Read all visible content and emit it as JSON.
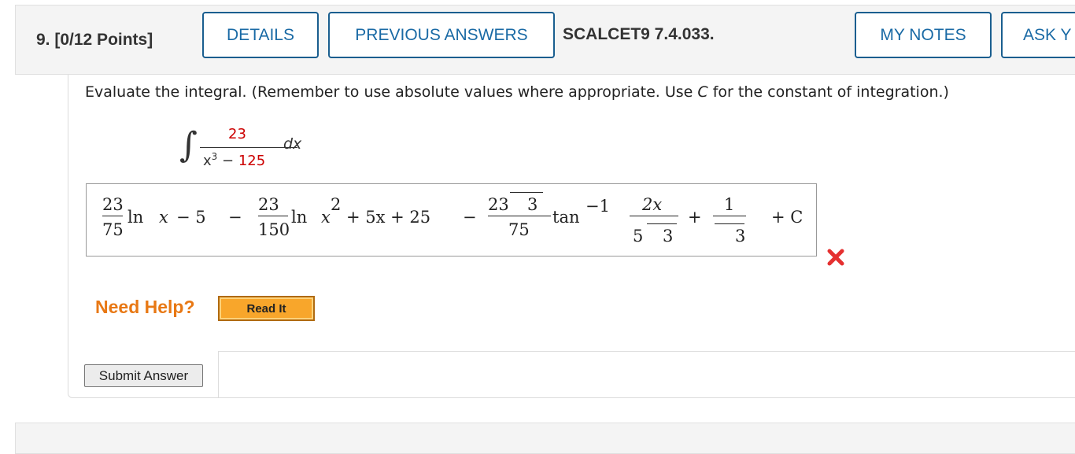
{
  "header": {
    "question_number": "9.",
    "points": "[0/12 Points]",
    "details_label": "DETAILS",
    "previous_answers_label": "PREVIOUS ANSWERS",
    "reference": "SCALCET9 7.4.033.",
    "my_notes_label": "MY NOTES",
    "ask_label": "ASK Y"
  },
  "question": {
    "prompt_before_c": "Evaluate the integral. (Remember to use absolute values where appropriate. Use ",
    "prompt_c": "C",
    "prompt_after_c": " for the constant of integration.)",
    "integrand_numerator": "23",
    "integrand_den_base": "x",
    "integrand_den_exp": "3",
    "integrand_den_op": " − ",
    "integrand_den_const": "125",
    "differential": "dx"
  },
  "answer": {
    "t1_num": "23",
    "t1_den": "75",
    "t1_fn": "ln",
    "t1_arg": "x",
    "t1_rest": "− 5",
    "minus1": "−",
    "t2_num": "23",
    "t2_den": "150",
    "t2_fn": "ln",
    "t2_arg": "x",
    "t2_exp": "2",
    "t2_rest": "+ 5x + 25",
    "minus2": "−",
    "t3_num": "23",
    "t3_rad": "3",
    "t3_den": "75",
    "t3_fn": "tan",
    "t3_exp": "−1",
    "t3_in_num": "2x",
    "t3_in_den_a": "5",
    "t3_in_den_rad": "3",
    "plus": "+",
    "t4_num": "1",
    "t4_den_rad": "3",
    "const": "+ C",
    "status_icon": "incorrect-x-icon",
    "status_color": "#e53030"
  },
  "help": {
    "need_help_label": "Need Help?",
    "read_it_label": "Read It"
  },
  "submit_label": "Submit Answer"
}
